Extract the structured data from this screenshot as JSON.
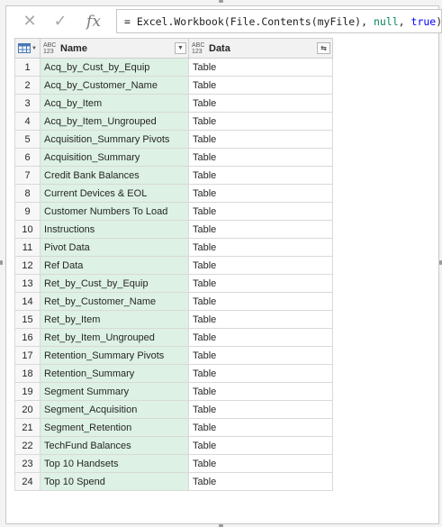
{
  "formula_bar": {
    "cancel_icon": "close-icon",
    "commit_icon": "check-icon",
    "fx_label": "fx",
    "formula_prefix": "= Excel.Workbook(File.Contents(myFile), ",
    "formula_null": "null",
    "formula_sep": ", ",
    "formula_true": "true",
    "formula_suffix": ")"
  },
  "columns": [
    {
      "type_badge_top": "ABC",
      "type_badge_bottom": "123",
      "label": "Name"
    },
    {
      "type_badge_top": "ABC",
      "type_badge_bottom": "123",
      "label": "Data"
    }
  ],
  "rows": [
    {
      "index": "1",
      "name": "Acq_by_Cust_by_Equip",
      "data": "Table"
    },
    {
      "index": "2",
      "name": "Acq_by_Customer_Name",
      "data": "Table"
    },
    {
      "index": "3",
      "name": "Acq_by_Item",
      "data": "Table"
    },
    {
      "index": "4",
      "name": "Acq_by_Item_Ungrouped",
      "data": "Table"
    },
    {
      "index": "5",
      "name": "Acquisition_Summary Pivots",
      "data": "Table"
    },
    {
      "index": "6",
      "name": "Acquisition_Summary",
      "data": "Table"
    },
    {
      "index": "7",
      "name": "Credit Bank Balances",
      "data": "Table"
    },
    {
      "index": "8",
      "name": "Current Devices & EOL",
      "data": "Table"
    },
    {
      "index": "9",
      "name": "Customer Numbers To Load",
      "data": "Table"
    },
    {
      "index": "10",
      "name": "Instructions",
      "data": "Table"
    },
    {
      "index": "11",
      "name": "Pivot Data",
      "data": "Table"
    },
    {
      "index": "12",
      "name": "Ref Data",
      "data": "Table"
    },
    {
      "index": "13",
      "name": "Ret_by_Cust_by_Equip",
      "data": "Table"
    },
    {
      "index": "14",
      "name": "Ret_by_Customer_Name",
      "data": "Table"
    },
    {
      "index": "15",
      "name": "Ret_by_Item",
      "data": "Table"
    },
    {
      "index": "16",
      "name": "Ret_by_Item_Ungrouped",
      "data": "Table"
    },
    {
      "index": "17",
      "name": "Retention_Summary Pivots",
      "data": "Table"
    },
    {
      "index": "18",
      "name": "Retention_Summary",
      "data": "Table"
    },
    {
      "index": "19",
      "name": "Segment Summary",
      "data": "Table"
    },
    {
      "index": "20",
      "name": "Segment_Acquisition",
      "data": "Table"
    },
    {
      "index": "21",
      "name": "Segment_Retention",
      "data": "Table"
    },
    {
      "index": "22",
      "name": "TechFund Balances",
      "data": "Table"
    },
    {
      "index": "23",
      "name": "Top 10 Handsets",
      "data": "Table"
    },
    {
      "index": "24",
      "name": "Top 10 Spend",
      "data": "Table"
    }
  ],
  "colors": {
    "name_column_bg": "#ddf1e4",
    "formula_literal": "#09885a",
    "formula_keyword": "#0000ff"
  }
}
